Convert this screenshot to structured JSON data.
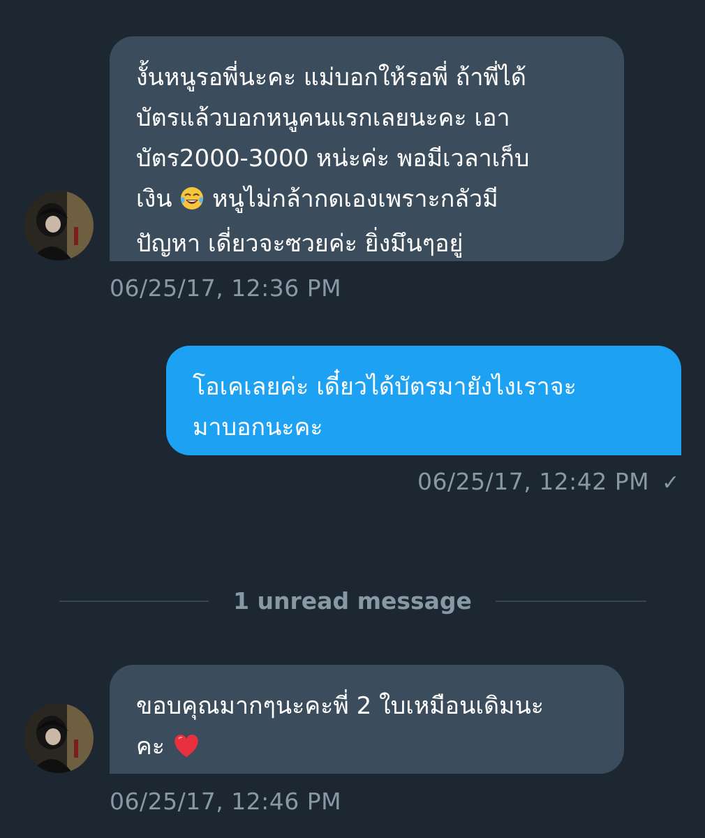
{
  "messages": [
    {
      "direction": "incoming",
      "text_line1": "งั้นหนูรอพี่นะคะ แม่บอกให้รอพี่ ถ้าพี่ได้",
      "text_line2": "บัตรแล้วบอกหนูคนแรกเลยนะคะ เอา",
      "text_line3": "บัตร2000-3000 หน่ะค่ะ พอมีเวลาเก็บ",
      "text_line4_before_emoji": "เงิน ",
      "emoji_1": "face-with-tears-of-joy",
      "text_line4_after_emoji": " หนูไม่กล้ากดเองเพราะกลัวมี",
      "text_line5": "ปัญหา เดี่ยวจะซวยค่ะ ยิ่งมึนๆอยู่",
      "timestamp": "06/25/17, 12:36 PM"
    },
    {
      "direction": "outgoing",
      "text_line1": "โอเคเลยค่ะ เดี๋ยวได้บัตรมายังไงเราจะ",
      "text_line2": "มาบอกนะคะ",
      "timestamp": "06/25/17, 12:42 PM",
      "status_icon": "check-icon",
      "status_glyph": "✓"
    },
    {
      "direction": "incoming",
      "text_line1": "ขอบคุณมากๆนะคะพี่ 2 ใบเหมือนเดิมนะ",
      "text_line2_before_emoji": "คะ ",
      "emoji_2": "red-heart",
      "timestamp": "06/25/17, 12:46 PM"
    }
  ],
  "divider": {
    "label": "1 unread message"
  },
  "colors": {
    "background": "#1c2732",
    "incoming_bubble": "#3b4d5c",
    "outgoing_bubble": "#1da1f2",
    "secondary_text": "#8899a6",
    "divider_line": "#38444d"
  }
}
